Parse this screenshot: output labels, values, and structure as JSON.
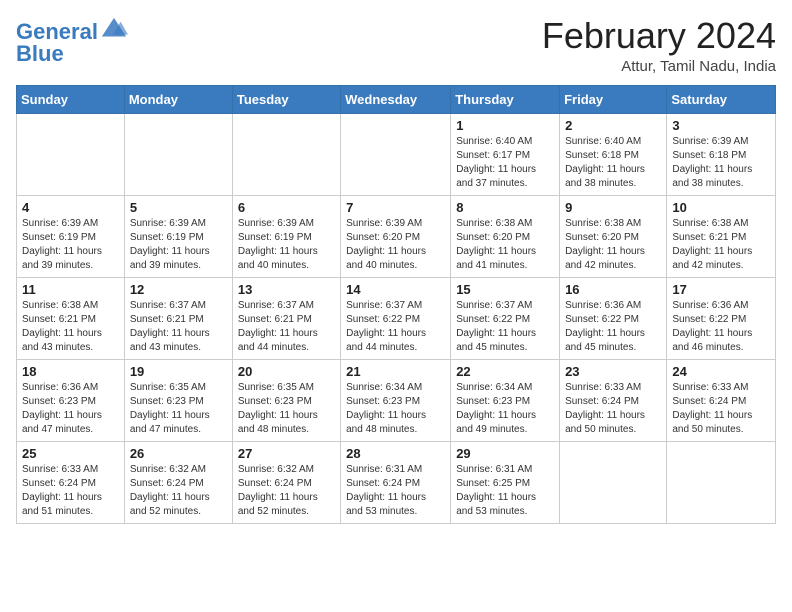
{
  "logo": {
    "line1": "General",
    "line2": "Blue"
  },
  "title": "February 2024",
  "location": "Attur, Tamil Nadu, India",
  "weekdays": [
    "Sunday",
    "Monday",
    "Tuesday",
    "Wednesday",
    "Thursday",
    "Friday",
    "Saturday"
  ],
  "weeks": [
    [
      {
        "day": "",
        "info": ""
      },
      {
        "day": "",
        "info": ""
      },
      {
        "day": "",
        "info": ""
      },
      {
        "day": "",
        "info": ""
      },
      {
        "day": "1",
        "info": "Sunrise: 6:40 AM\nSunset: 6:17 PM\nDaylight: 11 hours\nand 37 minutes."
      },
      {
        "day": "2",
        "info": "Sunrise: 6:40 AM\nSunset: 6:18 PM\nDaylight: 11 hours\nand 38 minutes."
      },
      {
        "day": "3",
        "info": "Sunrise: 6:39 AM\nSunset: 6:18 PM\nDaylight: 11 hours\nand 38 minutes."
      }
    ],
    [
      {
        "day": "4",
        "info": "Sunrise: 6:39 AM\nSunset: 6:19 PM\nDaylight: 11 hours\nand 39 minutes."
      },
      {
        "day": "5",
        "info": "Sunrise: 6:39 AM\nSunset: 6:19 PM\nDaylight: 11 hours\nand 39 minutes."
      },
      {
        "day": "6",
        "info": "Sunrise: 6:39 AM\nSunset: 6:19 PM\nDaylight: 11 hours\nand 40 minutes."
      },
      {
        "day": "7",
        "info": "Sunrise: 6:39 AM\nSunset: 6:20 PM\nDaylight: 11 hours\nand 40 minutes."
      },
      {
        "day": "8",
        "info": "Sunrise: 6:38 AM\nSunset: 6:20 PM\nDaylight: 11 hours\nand 41 minutes."
      },
      {
        "day": "9",
        "info": "Sunrise: 6:38 AM\nSunset: 6:20 PM\nDaylight: 11 hours\nand 42 minutes."
      },
      {
        "day": "10",
        "info": "Sunrise: 6:38 AM\nSunset: 6:21 PM\nDaylight: 11 hours\nand 42 minutes."
      }
    ],
    [
      {
        "day": "11",
        "info": "Sunrise: 6:38 AM\nSunset: 6:21 PM\nDaylight: 11 hours\nand 43 minutes."
      },
      {
        "day": "12",
        "info": "Sunrise: 6:37 AM\nSunset: 6:21 PM\nDaylight: 11 hours\nand 43 minutes."
      },
      {
        "day": "13",
        "info": "Sunrise: 6:37 AM\nSunset: 6:21 PM\nDaylight: 11 hours\nand 44 minutes."
      },
      {
        "day": "14",
        "info": "Sunrise: 6:37 AM\nSunset: 6:22 PM\nDaylight: 11 hours\nand 44 minutes."
      },
      {
        "day": "15",
        "info": "Sunrise: 6:37 AM\nSunset: 6:22 PM\nDaylight: 11 hours\nand 45 minutes."
      },
      {
        "day": "16",
        "info": "Sunrise: 6:36 AM\nSunset: 6:22 PM\nDaylight: 11 hours\nand 45 minutes."
      },
      {
        "day": "17",
        "info": "Sunrise: 6:36 AM\nSunset: 6:22 PM\nDaylight: 11 hours\nand 46 minutes."
      }
    ],
    [
      {
        "day": "18",
        "info": "Sunrise: 6:36 AM\nSunset: 6:23 PM\nDaylight: 11 hours\nand 47 minutes."
      },
      {
        "day": "19",
        "info": "Sunrise: 6:35 AM\nSunset: 6:23 PM\nDaylight: 11 hours\nand 47 minutes."
      },
      {
        "day": "20",
        "info": "Sunrise: 6:35 AM\nSunset: 6:23 PM\nDaylight: 11 hours\nand 48 minutes."
      },
      {
        "day": "21",
        "info": "Sunrise: 6:34 AM\nSunset: 6:23 PM\nDaylight: 11 hours\nand 48 minutes."
      },
      {
        "day": "22",
        "info": "Sunrise: 6:34 AM\nSunset: 6:23 PM\nDaylight: 11 hours\nand 49 minutes."
      },
      {
        "day": "23",
        "info": "Sunrise: 6:33 AM\nSunset: 6:24 PM\nDaylight: 11 hours\nand 50 minutes."
      },
      {
        "day": "24",
        "info": "Sunrise: 6:33 AM\nSunset: 6:24 PM\nDaylight: 11 hours\nand 50 minutes."
      }
    ],
    [
      {
        "day": "25",
        "info": "Sunrise: 6:33 AM\nSunset: 6:24 PM\nDaylight: 11 hours\nand 51 minutes."
      },
      {
        "day": "26",
        "info": "Sunrise: 6:32 AM\nSunset: 6:24 PM\nDaylight: 11 hours\nand 52 minutes."
      },
      {
        "day": "27",
        "info": "Sunrise: 6:32 AM\nSunset: 6:24 PM\nDaylight: 11 hours\nand 52 minutes."
      },
      {
        "day": "28",
        "info": "Sunrise: 6:31 AM\nSunset: 6:24 PM\nDaylight: 11 hours\nand 53 minutes."
      },
      {
        "day": "29",
        "info": "Sunrise: 6:31 AM\nSunset: 6:25 PM\nDaylight: 11 hours\nand 53 minutes."
      },
      {
        "day": "",
        "info": ""
      },
      {
        "day": "",
        "info": ""
      }
    ]
  ]
}
